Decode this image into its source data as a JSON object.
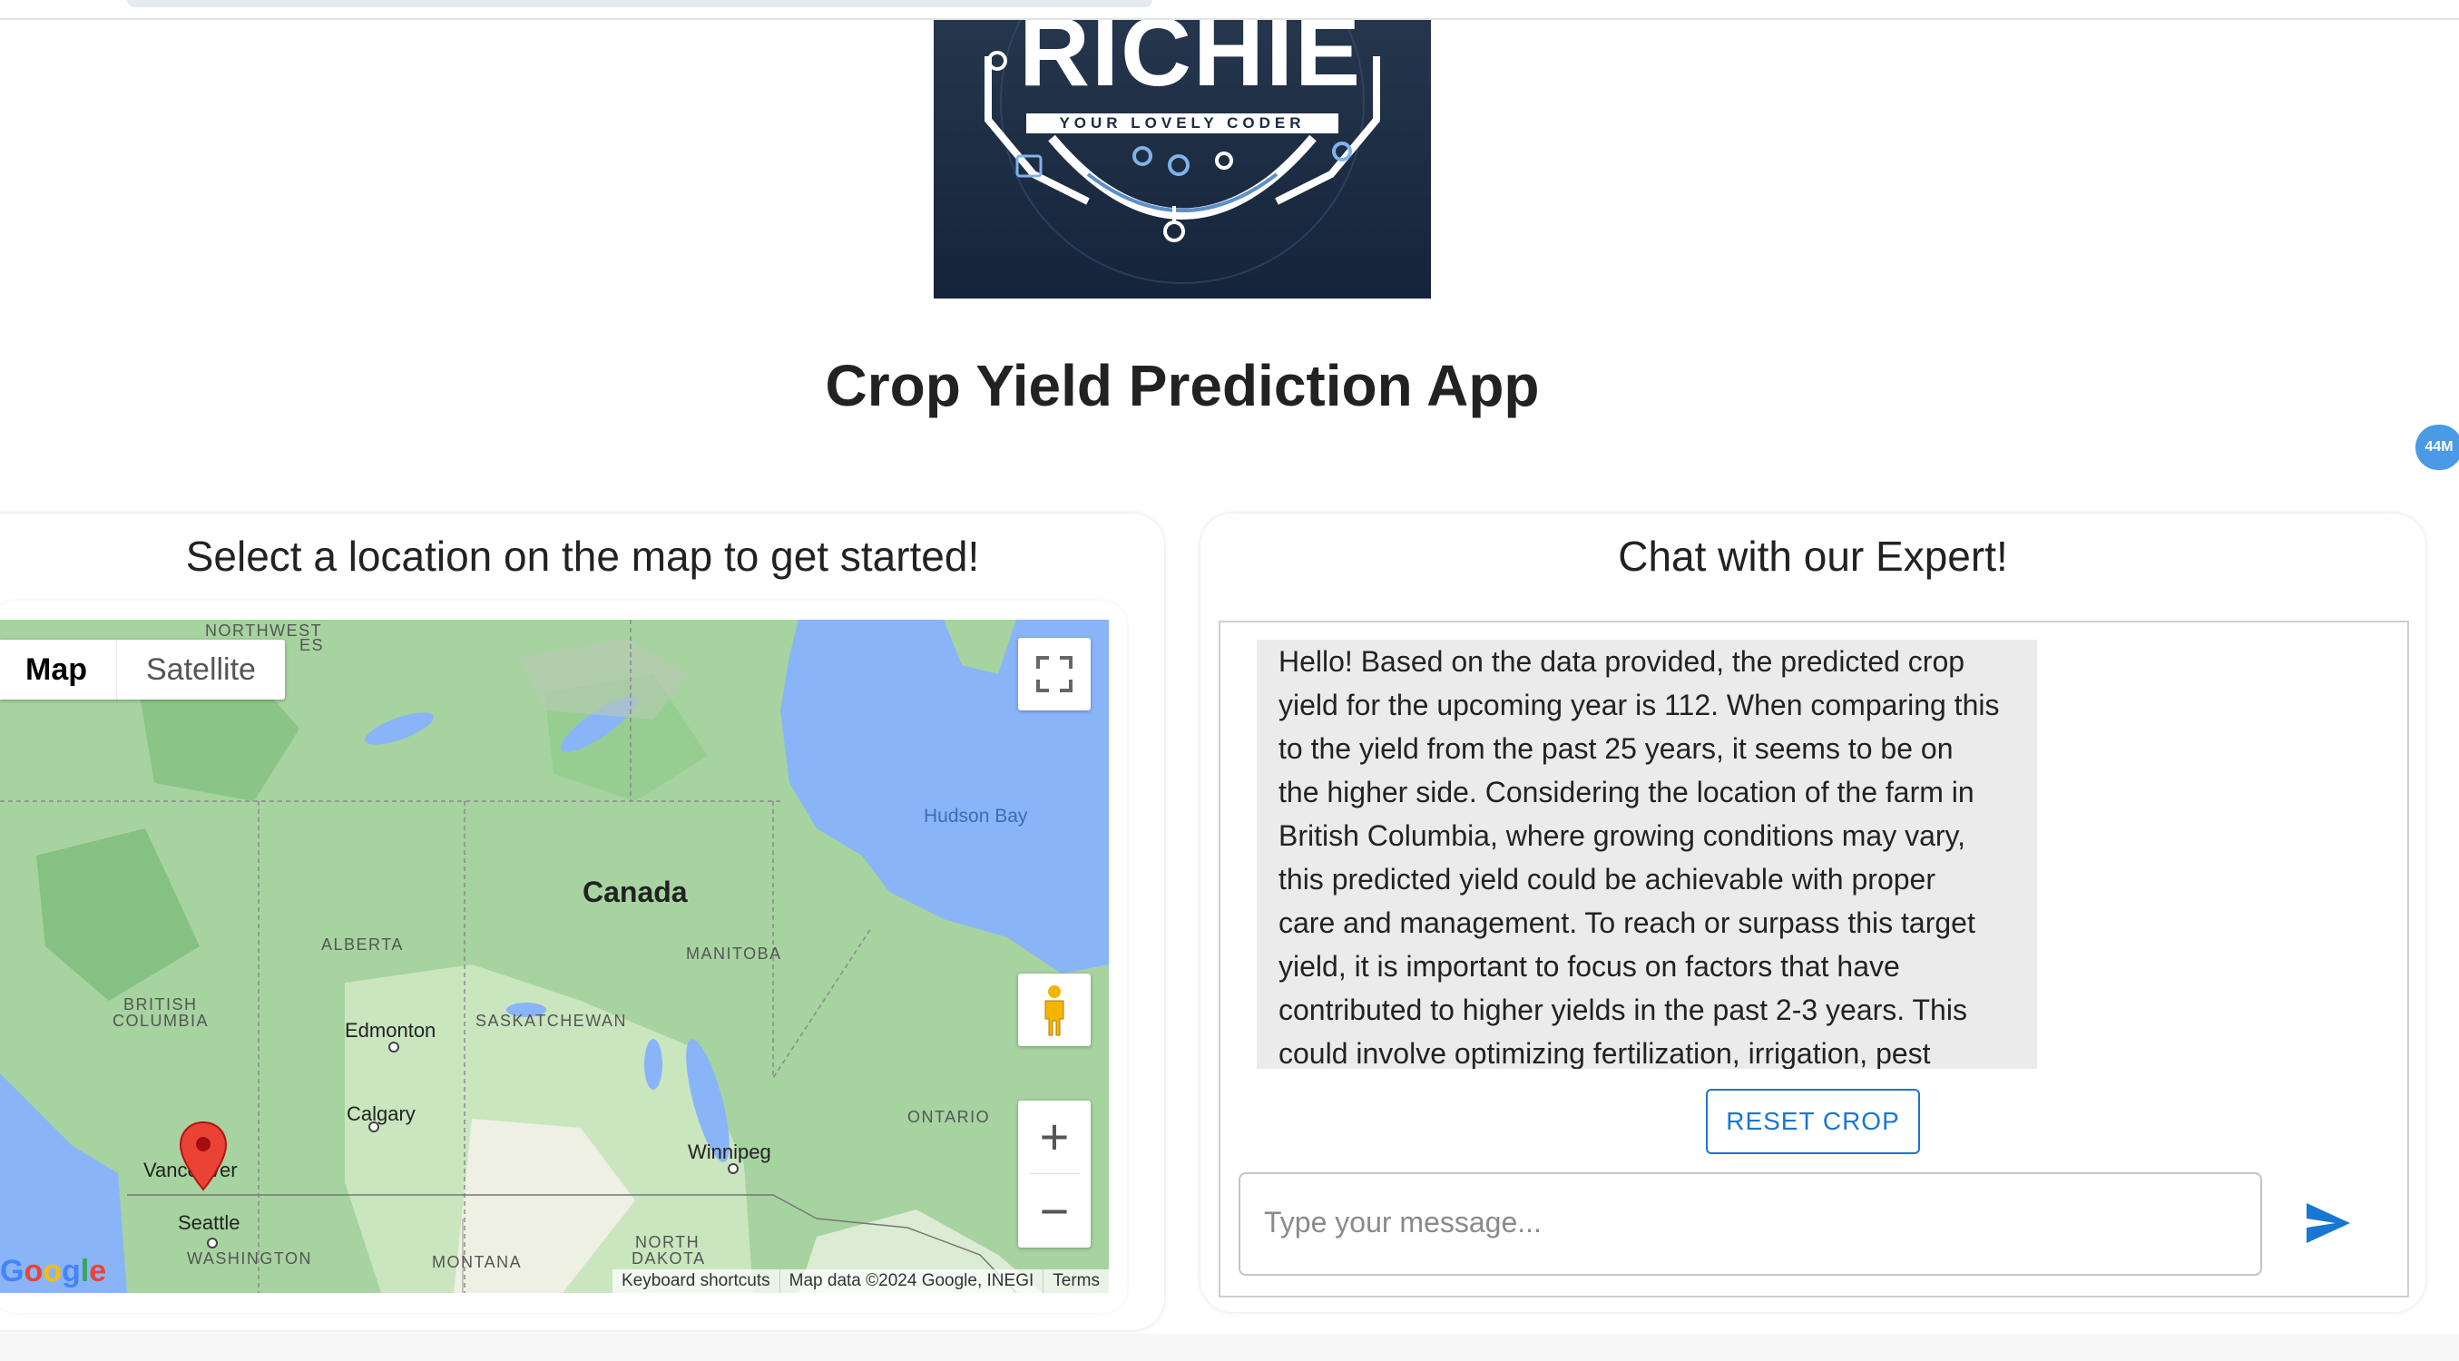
{
  "logo": {
    "text": "RICHIE",
    "tagline": "YOUR LOVELY CODER"
  },
  "app_title": "Crop Yield Prediction App",
  "badge": "44M",
  "map_panel": {
    "title": "Select a location on the map to get started!",
    "map_type": {
      "map": "Map",
      "satellite": "Satellite"
    },
    "labels": {
      "northwest": "NORTHWEST",
      "territories_tail": "ES",
      "hudson_bay": "Hudson Bay",
      "canada": "Canada",
      "alberta": "ALBERTA",
      "manitoba": "MANITOBA",
      "british": "BRITISH",
      "columbia": "COLUMBIA",
      "edmonton": "Edmonton",
      "saskatchewan": "SASKATCHEWAN",
      "calgary": "Calgary",
      "ontario": "ONTARIO",
      "winnipeg": "Winnipeg",
      "vancouver": "Vancouver",
      "seattle": "Seattle",
      "washington": "WASHINGTON",
      "montana": "MONTANA",
      "north": "NORTH",
      "dakota": "DAKOTA"
    },
    "attribution": {
      "shortcuts": "Keyboard shortcuts",
      "data": "Map data ©2024 Google, INEGI",
      "terms": "Terms"
    },
    "zoom_in": "+",
    "zoom_out": "−"
  },
  "chat_panel": {
    "title": "Chat with our Expert!",
    "message_lines": [
      "Hello! Based on the data provided, the predicted crop",
      "yield for the upcoming year is 112. When comparing this",
      "to the yield from the past 25 years, it seems to be on",
      "the higher side. Considering the location of the farm in",
      "British Columbia, where growing conditions may vary,",
      "this predicted yield could be achievable with proper",
      "care and management. To reach or surpass this target",
      "yield, it is important to focus on factors that have",
      "contributed to higher yields in the past 2-3 years. This",
      "could involve optimizing fertilization, irrigation, pest"
    ],
    "reset_label": "RESET CROP",
    "input_placeholder": "Type your message...",
    "input_value": ""
  },
  "colors": {
    "accent": "#1976d2",
    "water": "#8ab4f8",
    "land": "#a6d3a0",
    "marker": "#e33b2e"
  }
}
